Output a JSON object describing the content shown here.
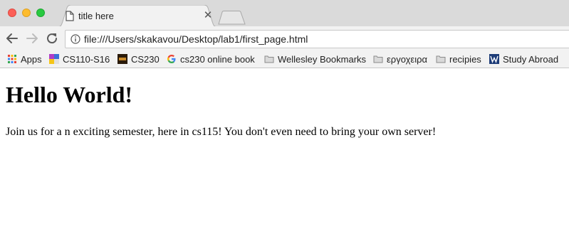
{
  "tab": {
    "title": "title here"
  },
  "toolbar": {
    "url": "file:///Users/skakavou/Desktop/lab1/first_page.html"
  },
  "bookmarks": [
    {
      "label": "Apps",
      "icon": "apps-grid-icon"
    },
    {
      "label": "CS110-S16",
      "icon": "cs110-icon"
    },
    {
      "label": "CS230",
      "icon": "cs230-icon"
    },
    {
      "label": "cs230 online book",
      "icon": "google-icon"
    },
    {
      "label": "Wellesley Bookmarks",
      "icon": "folder-icon"
    },
    {
      "label": "εργοχειρα",
      "icon": "folder-icon"
    },
    {
      "label": "recipies",
      "icon": "folder-icon"
    },
    {
      "label": "Study Abroad",
      "icon": "wellesley-w-icon"
    }
  ],
  "page": {
    "heading": "Hello World!",
    "paragraph": "Join us for a n exciting semester, here in cs115! You don't even need to bring your own server!"
  }
}
